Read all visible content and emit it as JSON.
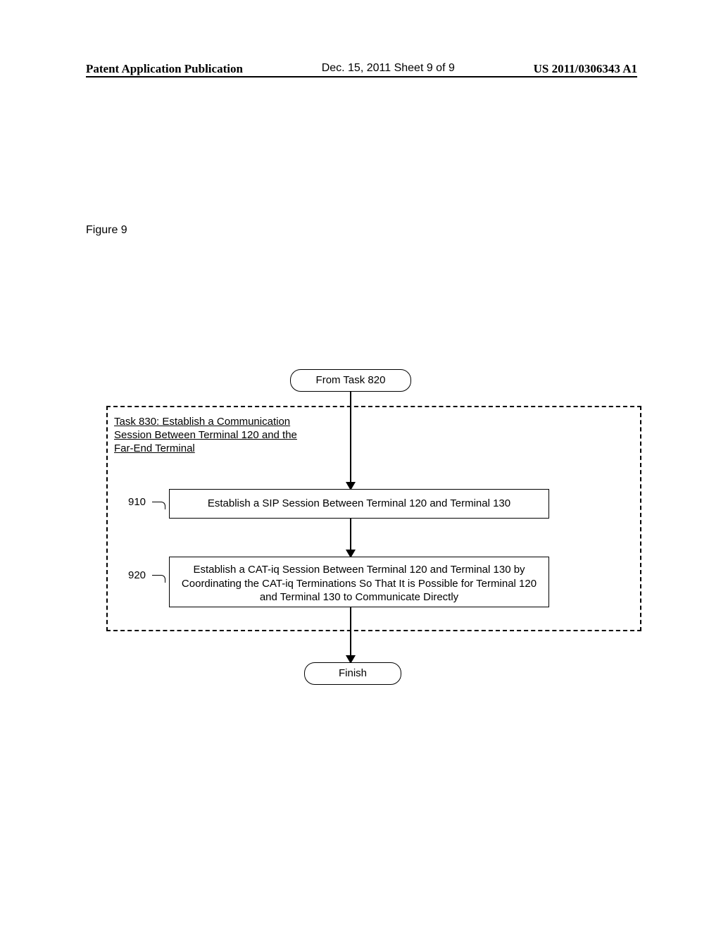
{
  "header": {
    "left": "Patent Application Publication",
    "center": "Dec. 15, 2011   Sheet 9 of 9",
    "right": "US 2011/0306343 A1"
  },
  "figure_label": "Figure 9",
  "flow": {
    "start": "From Task 820",
    "task_title_line1": "Task 830: Establish a Communication",
    "task_title_line2": "Session Between Terminal 120 and the",
    "task_title_line3": "Far-End Terminal",
    "ref_910": "910",
    "step_910": "Establish a SIP Session Between Terminal 120 and Terminal 130",
    "ref_920": "920",
    "step_920": "Establish a CAT-iq Session Between Terminal 120 and Terminal 130 by Coordinating the CAT-iq Terminations So That It is Possible for Terminal 120 and Terminal 130 to Communicate Directly",
    "finish": "Finish"
  }
}
